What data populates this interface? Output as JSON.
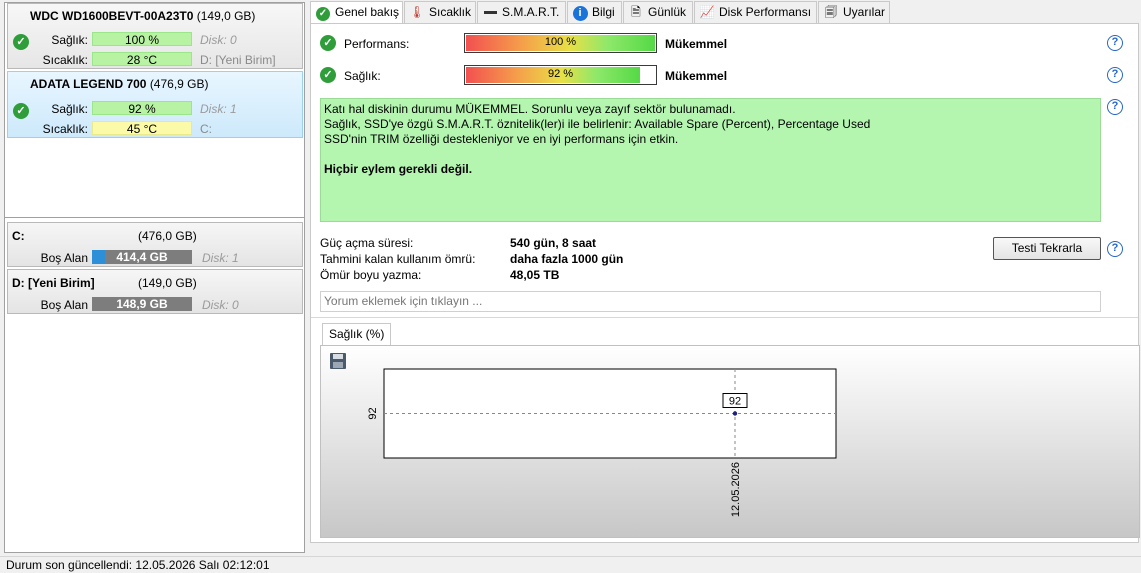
{
  "disks": [
    {
      "title": "WDC WD1600BEVT-00A23T0",
      "size": "(149,0 GB)",
      "health_label": "Sağlık:",
      "health_value": "100 %",
      "temp_label": "Sıcaklık:",
      "temp_value": "28 °C",
      "disk_id": "Disk: 0",
      "volume": "D: [Yeni Birim]"
    },
    {
      "title": "ADATA LEGEND 700",
      "size": "(476,9 GB)",
      "health_label": "Sağlık:",
      "health_value": "92 %",
      "temp_label": "Sıcaklık:",
      "temp_value": "45 °C",
      "disk_id": "Disk: 1",
      "volume": "C:"
    }
  ],
  "volumes": [
    {
      "name": "C:",
      "size": "(476,0 GB)",
      "free_label": "Boş Alan",
      "free_value": "414,4 GB",
      "free_fraction": 0.13,
      "disk_id": "Disk: 1"
    },
    {
      "name": "D: [Yeni Birim]",
      "size": "(149,0 GB)",
      "free_label": "Boş Alan",
      "free_value": "148,9 GB",
      "free_fraction": 0.0,
      "disk_id": "Disk: 0"
    }
  ],
  "tabs": [
    {
      "label": "Genel bakış",
      "icon": "check-circle-icon",
      "active": true
    },
    {
      "label": "Sıcaklık",
      "icon": "thermometer-icon"
    },
    {
      "label": "S.M.A.R.T.",
      "icon": "smart-bar-icon"
    },
    {
      "label": "Bilgi",
      "icon": "info-icon"
    },
    {
      "label": "Günlük",
      "icon": "log-document-icon"
    },
    {
      "label": "Disk Performansı",
      "icon": "performance-chart-icon"
    },
    {
      "label": "Uyarılar",
      "icon": "alerts-document-icon"
    }
  ],
  "overview": {
    "performance_label": "Performans:",
    "performance_value": "100 %",
    "performance_fraction": 1.0,
    "performance_rating": "Mükemmel",
    "health_label": "Sağlık:",
    "health_value": "92 %",
    "health_fraction": 0.92,
    "health_rating": "Mükemmel",
    "info_line1": "Katı hal diskinin durumu MÜKEMMEL. Sorunlu veya zayıf sektör bulunamadı.",
    "info_line2": "Sağlık, SSD'ye özgü S.M.A.R.T. öznitelik(ler)i ile belirlenir:  Available Spare (Percent), Percentage Used",
    "info_line3": "SSD'nin TRIM özelliği destekleniyor ve en iyi performans için etkin.",
    "info_action": "Hiçbir eylem gerekli değil.",
    "power_on_label": "Güç açma süresi:",
    "power_on_value": "540 gün, 8 saat",
    "lifetime_label": "Tahmini kalan kullanım ömrü:",
    "lifetime_value": "daha fazla 1000 gün",
    "writes_label": "Ömür boyu yazma:",
    "writes_value": "48,05 TB",
    "retest_button": "Testi Tekrarla",
    "comment_placeholder": "Yorum eklemek için tıklayın ..."
  },
  "chart_tab": "Sağlık (%)",
  "chart_data": {
    "type": "line",
    "x": [
      "12.05.2026"
    ],
    "series": [
      {
        "values": [
          92
        ]
      }
    ],
    "yticks": [
      "92"
    ],
    "data_labels": [
      "92"
    ]
  },
  "status_text": "Durum son güncellendi: 12.05.2026 Salı 02:12:01",
  "colors": {
    "ok_green": "#2f9e3a",
    "health_bar": "#b7f3a3",
    "temp_bar": "#fafaa8",
    "info_bg": "#b4f5b0",
    "help_blue": "#2767c7"
  }
}
